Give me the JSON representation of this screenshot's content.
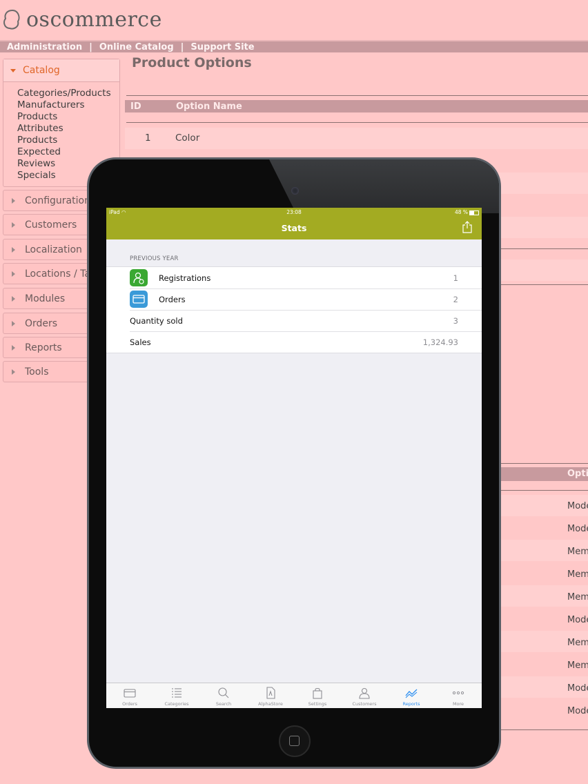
{
  "admin": {
    "logo_text": "oscommerce",
    "topnav": [
      "Administration",
      "Online Catalog",
      "Support Site"
    ],
    "sidebar_open": {
      "title": "Catalog",
      "links": [
        "Categories/Products",
        "Manufacturers",
        "Products",
        "Attributes",
        "Products",
        "Expected",
        "Reviews",
        "Specials"
      ]
    },
    "sidebar_items": [
      "Configuration",
      "Customers",
      "Localization",
      "Locations / Taxes",
      "Modules",
      "Orders",
      "Reports",
      "Tools"
    ],
    "page_title": "Product Options",
    "table_headers": {
      "id": "ID",
      "name": "Option Name"
    },
    "rows": [
      {
        "id": "1",
        "name": "Color"
      }
    ],
    "options_header": "Opti",
    "options_values": [
      "Mode",
      "Mode",
      "Mem",
      "Mem",
      "Mem",
      "Mode",
      "Mem",
      "Mem",
      "Mode",
      "Mode"
    ]
  },
  "ipad": {
    "status": {
      "carrier": "iPad",
      "time": "23:08",
      "battery": "48 %"
    },
    "nav_title": "Stats",
    "section_header": "PREVIOUS YEAR",
    "stats": [
      {
        "label": "Registrations",
        "value": "1",
        "icon": "registrations-icon",
        "color": "#3aa832"
      },
      {
        "label": "Orders",
        "value": "2",
        "icon": "card-icon",
        "color": "#3a9ad8"
      },
      {
        "label": "Quantity sold",
        "value": "3"
      },
      {
        "label": "Sales",
        "value": "1,324.93"
      }
    ],
    "tabs": [
      {
        "label": "Orders",
        "icon": "card-icon"
      },
      {
        "label": "Categories",
        "icon": "list-icon"
      },
      {
        "label": "Search",
        "icon": "search-icon"
      },
      {
        "label": "AlphaStore",
        "icon": "document-icon"
      },
      {
        "label": "Settings",
        "icon": "bag-icon"
      },
      {
        "label": "Customers",
        "icon": "person-icon"
      },
      {
        "label": "Reports",
        "icon": "chart-icon"
      },
      {
        "label": "More",
        "icon": "more-icon"
      }
    ],
    "nav_bar_color": "#a3ab22",
    "active_tab_color": "#2b8ef0"
  }
}
